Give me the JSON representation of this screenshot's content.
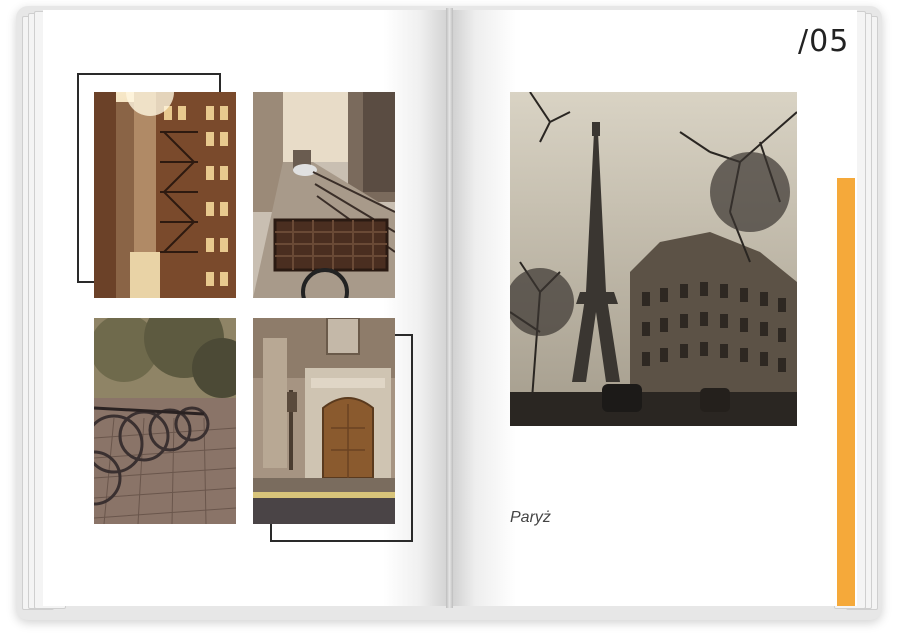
{
  "page_number": "/05",
  "caption": "Paryż",
  "colors": {
    "accent": "#f5a93a",
    "frame": "#2a2a2a",
    "page": "#ffffff"
  },
  "photos": {
    "left_top_left": "alley-fire-escape-photo",
    "left_top_right": "street-bicycle-basket-photo",
    "left_bottom_left": "parked-bicycles-photo",
    "left_bottom_right": "old-wooden-door-photo",
    "right_main": "eiffel-tower-photo"
  }
}
